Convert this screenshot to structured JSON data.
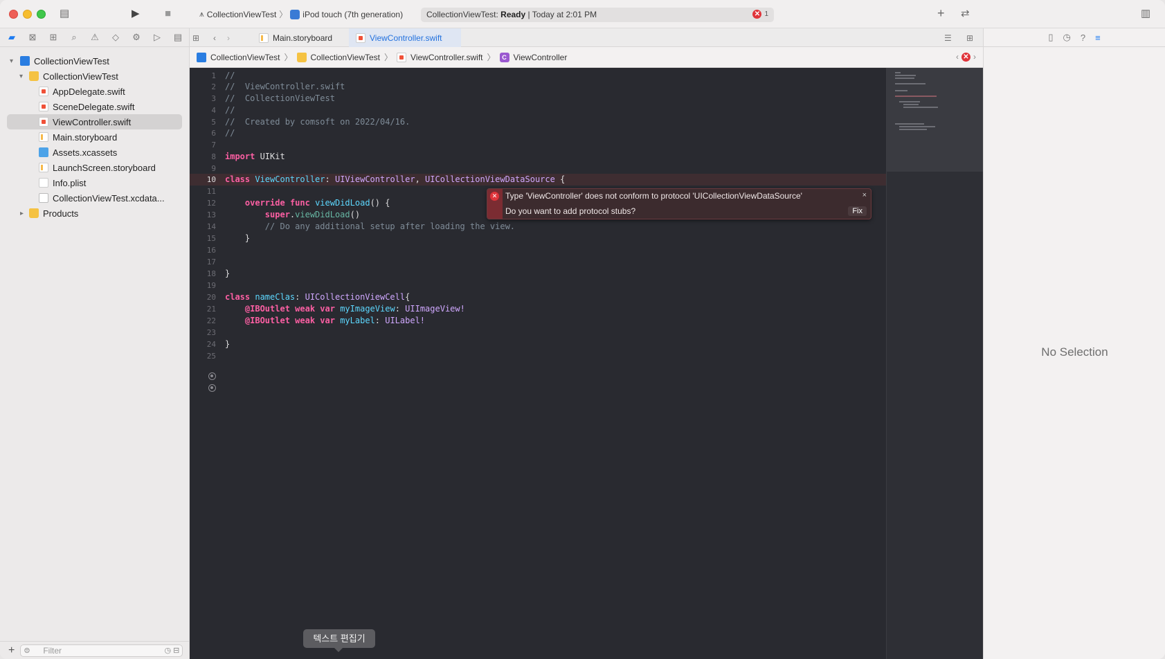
{
  "titlebar": {
    "scheme_project": "CollectionViewTest",
    "scheme_device": "iPod touch (7th generation)",
    "status_project": "CollectionViewTest:",
    "status_state": "Ready",
    "status_time": "| Today at 2:01 PM",
    "error_count": "1"
  },
  "tabs": [
    {
      "label": "Main.storyboard"
    },
    {
      "label": "ViewController.swift"
    }
  ],
  "jumpbar": [
    "CollectionViewTest",
    "CollectionViewTest",
    "ViewController.swift",
    "ViewController"
  ],
  "sidebar": {
    "project": "CollectionViewTest",
    "group": "CollectionViewTest",
    "files": [
      "AppDelegate.swift",
      "SceneDelegate.swift",
      "ViewController.swift",
      "Main.storyboard",
      "Assets.xcassets",
      "LaunchScreen.storyboard",
      "Info.plist",
      "CollectionViewTest.xcdata..."
    ],
    "products": "Products",
    "filter_placeholder": "Filter"
  },
  "code": {
    "line_numbers": [
      "1",
      "2",
      "3",
      "4",
      "5",
      "6",
      "7",
      "8",
      "9",
      "10",
      "11",
      "12",
      "13",
      "14",
      "15",
      "16",
      "17",
      "18",
      "19",
      "20",
      "21",
      "22",
      "23",
      "24",
      "25"
    ],
    "c1": "//",
    "c2": "//  ViewController.swift",
    "c3": "//  CollectionViewTest",
    "c4": "//",
    "c5": "//  Created by comsoft on 2022/04/16.",
    "c6": "//",
    "l8_kw": "import",
    "l8_rest": " UIKit",
    "l10_kw": "class",
    "l10_name": "ViewController",
    "l10_colon": ": ",
    "l10_t1": "UIViewController",
    "l10_comma": ", ",
    "l10_t2": "UICollectionViewDataSource",
    "l10_brace": " {",
    "l12_kw1": "override",
    "l12_kw2": "func",
    "l12_name": "viewDidLoad",
    "l12_rest": "() {",
    "l13_kw": "super",
    "l13_dot": ".",
    "l13_fn": "viewDidLoad",
    "l13_rest": "()",
    "l14": "// Do any additional setup after loading the view.",
    "l15": "}",
    "l18": "}",
    "l20_kw": "class",
    "l20_name": "nameClas",
    "l20_colon": ": ",
    "l20_t": "UICollectionViewCell",
    "l20_brace": "{",
    "l21_attr": "@IBOutlet",
    "l21_kw": "weak var",
    "l21_name": "myImageView",
    "l21_colon": ": ",
    "l21_t": "UIImageView!",
    "l22_attr": "@IBOutlet",
    "l22_kw": "weak var",
    "l22_name": "myLabel",
    "l22_colon": ": ",
    "l22_t": "UILabel!",
    "l24": "}"
  },
  "issue": {
    "message": "Type 'ViewController' does not conform to protocol 'UICollectionViewDataSource'",
    "question": "Do you want to add protocol stubs?",
    "fix_label": "Fix",
    "close": "×"
  },
  "tooltip": "텍스트 편집기",
  "inspector": {
    "empty_text": "No Selection"
  }
}
